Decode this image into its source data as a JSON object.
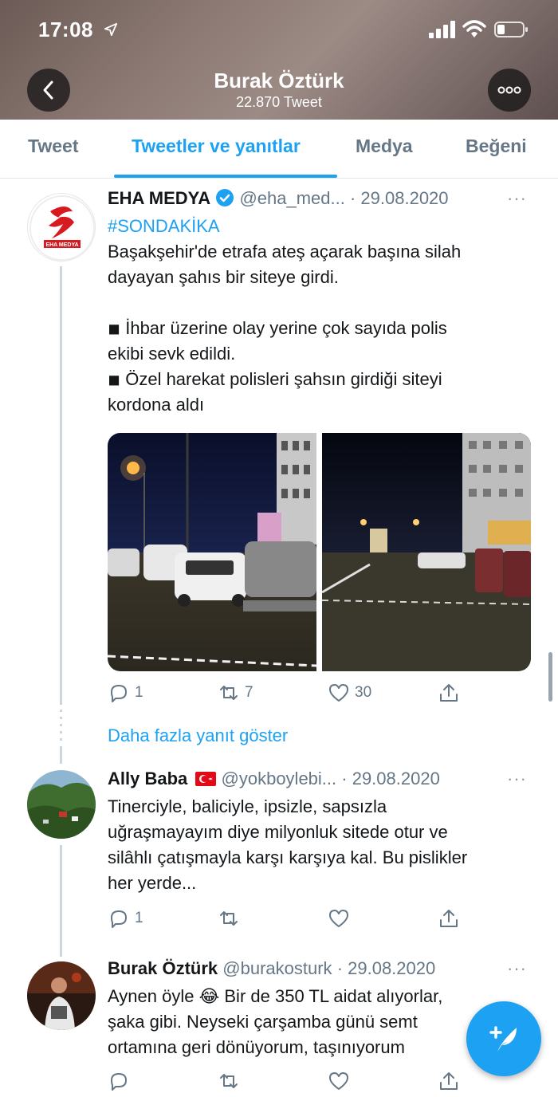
{
  "status_bar": {
    "time": "17:08"
  },
  "profile": {
    "name": "Burak Öztürk",
    "tweet_count": "22.870 Tweet"
  },
  "tabs": [
    {
      "label": "Tweet",
      "active": false
    },
    {
      "label": "Tweetler ve yanıtlar",
      "active": true
    },
    {
      "label": "Medya",
      "active": false
    },
    {
      "label": "Beğeni",
      "active": false
    }
  ],
  "tweets": [
    {
      "name": "EHA MEDYA",
      "verified": true,
      "handle": "@eha_med...",
      "date": "· 29.08.2020",
      "more": "···",
      "avatar_label": "EHA MEDYA",
      "hashtag": "#SONDAKİKA",
      "lines": [
        "Başakşehir'de etrafa ateş açarak başına silah",
        "dayayan şahıs bir siteye girdi.",
        "",
        "◾ İhbar üzerine olay yerine çok sayıda polis",
        "ekibi sevk edildi.",
        "◾ Özel harekat polisleri şahsın girdiği siteyi",
        "kordona aldı"
      ],
      "replies": "1",
      "retweets": "7",
      "likes": "30"
    },
    {
      "name": "Ally Baba",
      "handle": "@yokboylebi...",
      "date": "· 29.08.2020",
      "more": "···",
      "lines": [
        "Tinerciyle, baliciyle, ipsizle, sapsızla",
        "uğraşmayayım diye milyonluk sitede otur ve",
        "silâhlı çatışmayla karşı karşıya kal. Bu pislikler",
        "her yerde..."
      ],
      "replies": "1",
      "retweets": "",
      "likes": ""
    },
    {
      "name": "Burak Öztürk",
      "handle": "@burakosturk",
      "date": "· 29.08.2020",
      "more": "···",
      "lines": [
        "Aynen öyle 😂 Bir de 350 TL aidat alıyorlar,",
        "şaka gibi. Neyseki çarşamba günü semt",
        "ortamına geri dönüyorum, taşınıyorum"
      ],
      "replies": "",
      "retweets": "",
      "likes": ""
    }
  ],
  "show_more_replies": "Daha fazla yanıt göster",
  "colors": {
    "accent": "#1da1f2",
    "muted": "#657786",
    "text": "#14171a"
  }
}
